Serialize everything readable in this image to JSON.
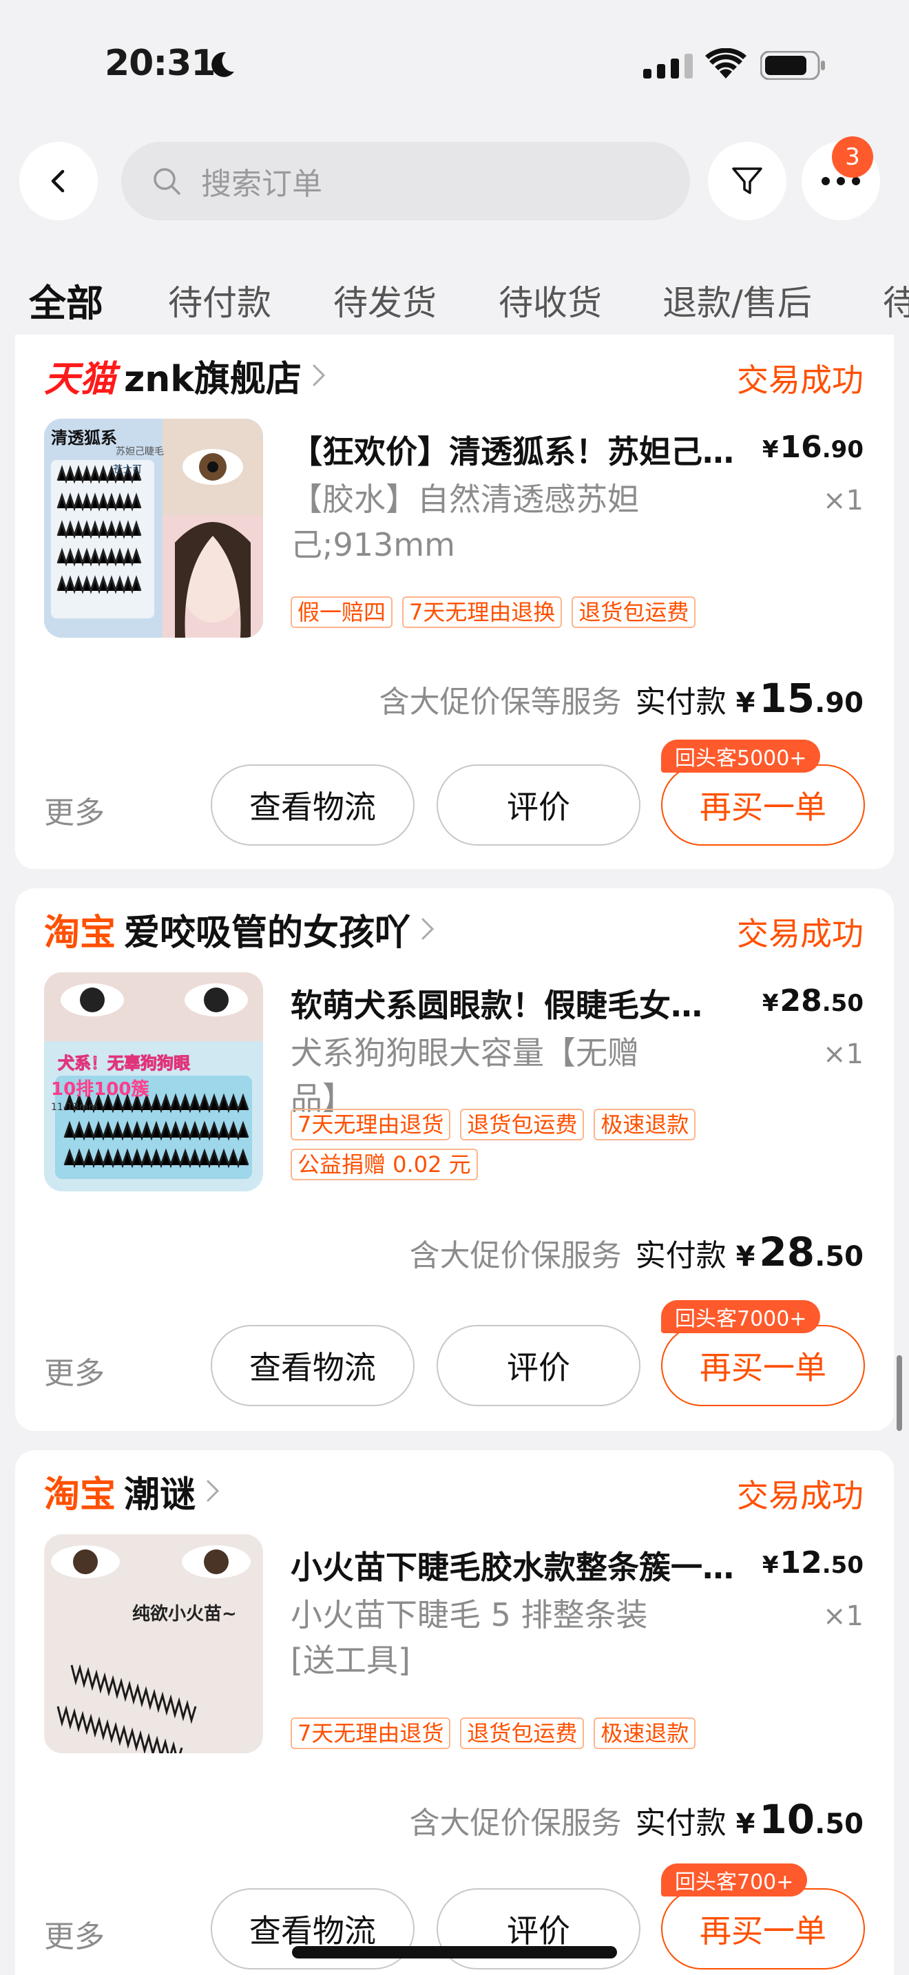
{
  "status_bar": {
    "time": "20:31"
  },
  "search": {
    "placeholder": "搜索订单"
  },
  "header": {
    "more_badge": "3"
  },
  "tabs": [
    "全部",
    "待付款",
    "待发货",
    "待收货",
    "退款/售后",
    "待"
  ],
  "orders": [
    {
      "platform": "天猫",
      "shop": "znk旗舰店",
      "status": "交易成功",
      "title": "【狂欢价】清透狐系！苏妲己…",
      "price": {
        "symbol": "¥",
        "int": "16",
        "dec": ".90"
      },
      "sku": "【胶水】自然清透感苏妲己;913mm",
      "qty": "×1",
      "tags": [
        "假一赔四",
        "7天无理由退换",
        "退货包运费"
      ],
      "service": "含大促价保等服务",
      "paid_label": "实付款",
      "paid": {
        "symbol": "¥",
        "int": "15",
        "dec": ".90"
      },
      "more": "更多",
      "buttons": {
        "logistics": "查看物流",
        "review": "评价",
        "rebuy": "再买一单"
      },
      "rebuy_badge": "回头客5000+",
      "thumb_text": [
        "清透狐系",
        "苏妲己睫毛",
        "苍士可"
      ]
    },
    {
      "platform": "淘宝",
      "shop": "爱咬吸管的女孩吖",
      "status": "交易成功",
      "title": "软萌犬系圆眼款！假睫毛女…",
      "price": {
        "symbol": "¥",
        "int": "28",
        "dec": ".50"
      },
      "sku": "犬系狗狗眼大容量【无赠品】",
      "qty": "×1",
      "tags": [
        "7天无理由退货",
        "退货包运费",
        "极速退款",
        "公益捐赠 0.02 元"
      ],
      "service": "含大促价保服务",
      "paid_label": "实付款",
      "paid": {
        "symbol": "¥",
        "int": "28",
        "dec": ".50"
      },
      "more": "更多",
      "buttons": {
        "logistics": "查看物流",
        "review": "评价",
        "rebuy": "再买一单"
      },
      "rebuy_badge": "回头客7000+",
      "thumb_text": [
        "犬系！无辜狗狗眼",
        "10排100簇",
        "11-13mm"
      ]
    },
    {
      "platform": "淘宝",
      "shop": "潮谜",
      "status": "交易成功",
      "title": "小火苗下睫毛胶水款整条簇一…",
      "price": {
        "symbol": "¥",
        "int": "12",
        "dec": ".50"
      },
      "sku": "小火苗下睫毛 5 排整条装[送工具]",
      "qty": "×1",
      "tags": [
        "7天无理由退货",
        "退货包运费",
        "极速退款"
      ],
      "service": "含大促价保服务",
      "paid_label": "实付款",
      "paid": {
        "symbol": "¥",
        "int": "10",
        "dec": ".50"
      },
      "more": "更多",
      "buttons": {
        "logistics": "查看物流",
        "review": "评价",
        "rebuy": "再买一单"
      },
      "rebuy_badge": "回头客700+",
      "thumb_text": [
        "纯欲小火苗~"
      ]
    }
  ],
  "colors": {
    "accent": "#ff5000",
    "tmall": "#ff1a1a",
    "background": "#f2f2f4",
    "badge": "#ff5a2c"
  }
}
